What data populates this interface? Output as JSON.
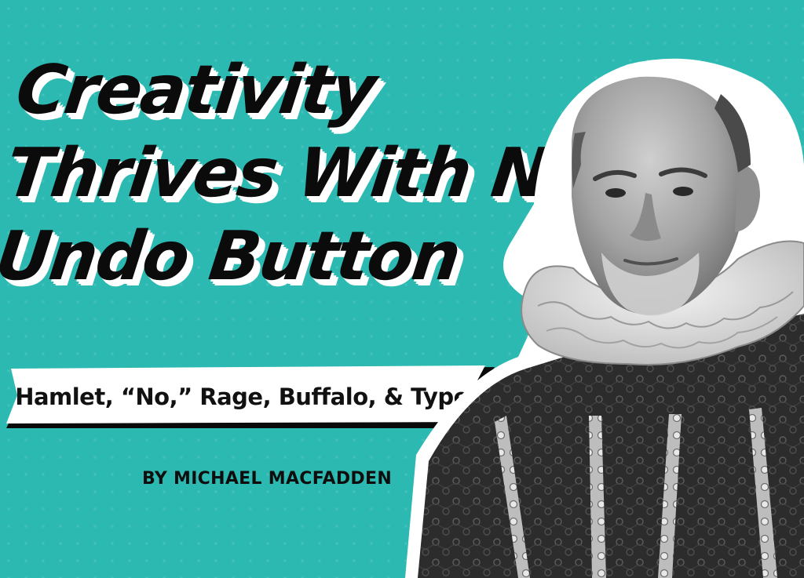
{
  "headline": {
    "lines": [
      "Creativity",
      "Thrives With No",
      "Undo Button"
    ]
  },
  "banner": {
    "subtitle": "Hamlet, “No,” Rage, Buffalo, & Type"
  },
  "byline": {
    "text": "BY MICHAEL MACFADDEN"
  },
  "portrait": {
    "description": "black-and-white photo of a bald man with a white ruffled collar"
  },
  "colors": {
    "background": "#2cb9b1",
    "text": "#0b0b0b",
    "banner": "#ffffff",
    "outline": "#ffffff"
  }
}
